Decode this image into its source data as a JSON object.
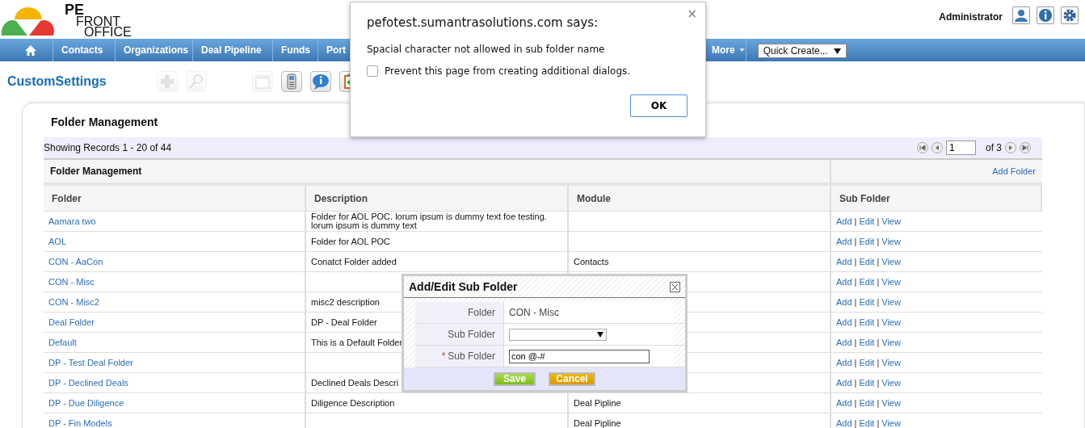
{
  "logo": {
    "lines": [
      "PE",
      "FRONT",
      "OFFICE"
    ]
  },
  "header": {
    "user": "Administrator"
  },
  "nav": {
    "items": [
      "Contacts",
      "Organizations",
      "Deal Pipeline",
      "Funds",
      "Port"
    ],
    "more": "More",
    "quick_create": "Quick Create..."
  },
  "page_title": "CustomSettings",
  "toolbar": [
    {
      "kind": "add",
      "disabled": true
    },
    {
      "kind": "search",
      "disabled": true
    },
    {
      "kind": "calendar",
      "disabled": true
    },
    {
      "kind": "phone",
      "disabled": false
    },
    {
      "kind": "chat",
      "disabled": false
    },
    {
      "kind": "clipboard",
      "disabled": false
    }
  ],
  "panel": {
    "title": "Folder Management",
    "records": "Showing Records 1 - 20 of 44",
    "pager": {
      "page": "1",
      "of": "of 3"
    },
    "table": {
      "caption": "Folder Management",
      "add_link": "Add Folder",
      "columns": [
        "Folder",
        "Description",
        "Module",
        "Sub Folder"
      ],
      "rows": [
        {
          "folder": "Aamara two",
          "description": "Folder for AOL POC. lorum ipsum is dummy text foe testing. lorum ipsum is dummy text",
          "actions": [
            "Add",
            "|",
            "Edit",
            "|",
            "View"
          ]
        },
        {
          "folder": "AOL",
          "description": "Folder for AOL POC",
          "actions": [
            "Add",
            "|",
            "Edit",
            "|",
            "View"
          ]
        },
        {
          "folder": "CON - AaCon",
          "description": "Conatct Folder added",
          "module": "Contacts",
          "actions": [
            "Add",
            "|",
            "Edit",
            "|",
            "View"
          ]
        },
        {
          "folder": "CON - Misc",
          "actions": [
            "Add",
            "|",
            "Edit",
            "|",
            "View"
          ]
        },
        {
          "folder": "CON - Misc2",
          "description": "misc2 description",
          "actions": [
            "Add",
            "|",
            "Edit",
            "|",
            "View"
          ]
        },
        {
          "folder": "Deal Folder",
          "description": "DP - Deal Folder",
          "actions": [
            "Add",
            "|",
            "Edit",
            "|",
            "View"
          ]
        },
        {
          "folder": "Default",
          "description": "This is a Default Folder",
          "actions": [
            "Add",
            "|",
            "Edit",
            "|",
            "View"
          ]
        },
        {
          "folder": "DP - Test Deal Folder",
          "actions": [
            "Add",
            "|",
            "Edit",
            "|",
            "View"
          ]
        },
        {
          "folder": "DP - Declined Deals",
          "description": "Declined Deals Descri",
          "actions": [
            "Add",
            "|",
            "Edit",
            "|",
            "View"
          ]
        },
        {
          "folder": "DP - Due Diligence",
          "description": "Diligence Description",
          "module": "Deal Pipline",
          "actions": [
            "Add",
            "|",
            "Edit",
            "|",
            "View"
          ]
        },
        {
          "folder": "DP - Fin Models",
          "module": "Deal Pipline",
          "actions": [
            "Add",
            "|",
            "Edit",
            "|",
            "View"
          ]
        }
      ]
    }
  },
  "subfolder_dialog": {
    "title": "Add/Edit Sub Folder",
    "fields": [
      {
        "kind": "text",
        "label": "Folder",
        "value": "CON - Misc",
        "required": false
      },
      {
        "kind": "select",
        "label": "Sub Folder",
        "required": false
      },
      {
        "kind": "input",
        "label": "Sub Folder",
        "value": "con @-#",
        "required": true
      }
    ],
    "required_mark": "*",
    "buttons": [
      {
        "kind": "save",
        "label": "Save"
      },
      {
        "kind": "cancel",
        "label": "Cancel"
      }
    ]
  },
  "alert": {
    "title": "pefotest.sumantrasolutions.com says:",
    "close": "×",
    "message": "Spacial character not allowed in sub folder name",
    "checkbox": {
      "label": "Prevent this page from creating additional dialogs.",
      "checked": false
    },
    "button": "OK"
  }
}
